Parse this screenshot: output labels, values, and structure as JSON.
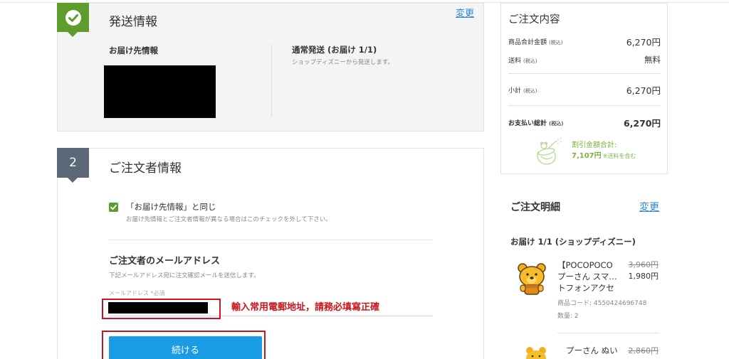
{
  "colors": {
    "accent_green": "#5f9c2e",
    "step_badge": "#5b6877",
    "link_blue": "#2f86d6",
    "button_blue": "#1a9be6",
    "annotation_red": "#c8161d",
    "discount_green": "#7bb13f"
  },
  "shipping": {
    "badge_icon": "check-icon",
    "title": "発送情報",
    "change_link": "変更",
    "address_heading": "お届け先情報",
    "method_heading": "通常発送 (お届け 1/1)",
    "method_note": "ショップディズニーから発送します。"
  },
  "orderer": {
    "step_number": "2",
    "title": "ご注文者情報",
    "same_as_shipping": {
      "checked": true,
      "label": "「お届け先情報」と同じ",
      "note": "お届け先情報とご注文者情報が異なる場合はこのチェックを外して下さい。"
    },
    "email": {
      "heading": "ご注文者のメールアドレス",
      "note": "下記メールアドレス宛に注文確認メールを送信します。",
      "label": "メールアドレス *必須"
    },
    "annotation": "輸入常用電郵地址，請務必填寫正確",
    "continue_button": "続ける"
  },
  "summary": {
    "title": "ご注文内容",
    "rows": [
      {
        "label": "商品合計金額",
        "tax": "(税込)",
        "value": "6,270円"
      },
      {
        "label": "送料",
        "tax": "(税込)",
        "value": "無料"
      },
      {
        "label": "小計",
        "tax": "(税込)",
        "value": "6,270円"
      },
      {
        "label": "お支払い総計",
        "tax": "(税込)",
        "value": "6,270円"
      }
    ],
    "discount": {
      "icon": "honey-pot-icon",
      "label": "割引金額合計:",
      "amount": "7,107円",
      "note": "※送料を含む"
    }
  },
  "details": {
    "title": "ご注文明細",
    "change_link": "変更",
    "delivery_heading": "お届け 1/1 (ショップディズニー)",
    "items": [
      {
        "image_icon": "pooh-face-icon",
        "name_lines": [
          "【POCOPOCO",
          "プーさん スマ…",
          "トフォンアクセ"
        ],
        "original_price": "3,960円",
        "price": "1,980円",
        "code": "商品コード: 4550424696748",
        "quantity": "数量: 2"
      },
      {
        "image_icon": "pooh-plush-icon",
        "name_lines": [
          "プーさん ぬい"
        ],
        "original_price": "2,860円"
      }
    ]
  }
}
